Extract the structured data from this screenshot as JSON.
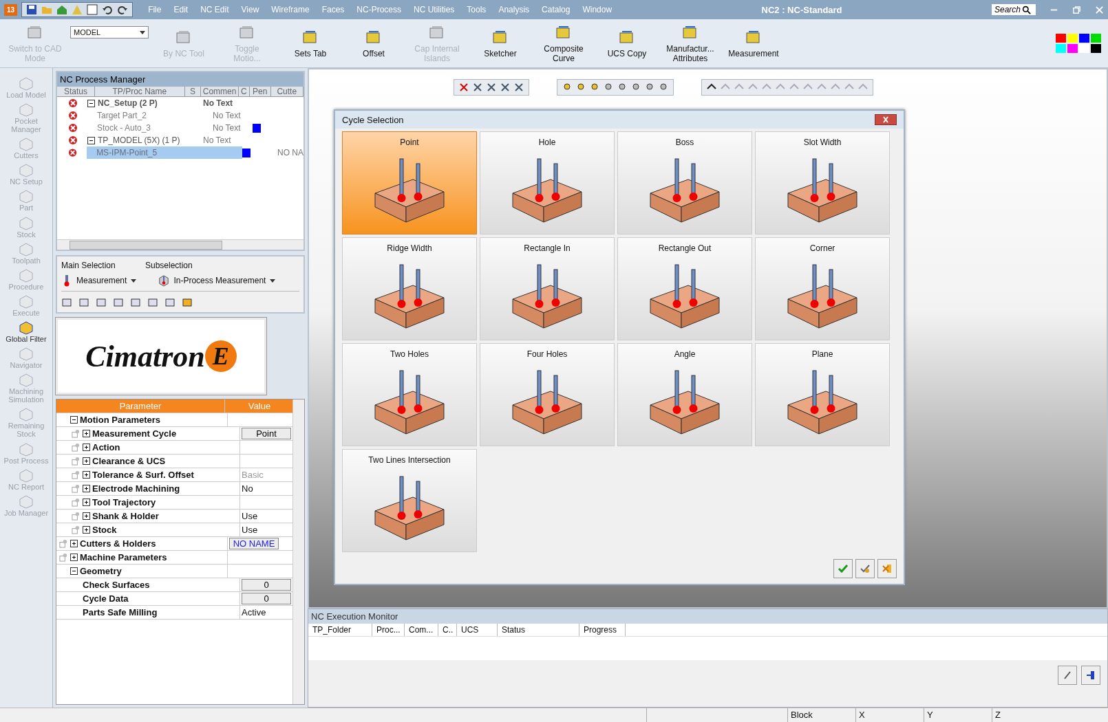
{
  "titlebar": {
    "app_badge": "13",
    "title": "NC2 : NC-Standard",
    "search": {
      "placeholder": "Search"
    }
  },
  "menu": [
    "File",
    "Edit",
    "NC Edit",
    "View",
    "Wireframe",
    "Faces",
    "NC-Process",
    "NC Utilities",
    "Tools",
    "Analysis",
    "Catalog",
    "Window"
  ],
  "ribbon": [
    {
      "kind": "button",
      "label": "Switch to CAD Mode",
      "disabled": true
    },
    {
      "kind": "select",
      "label": "MODEL"
    },
    {
      "kind": "button",
      "label": "By NC Tool",
      "disabled": true
    },
    {
      "kind": "button",
      "label": "Toggle Motio...",
      "disabled": true
    },
    {
      "kind": "button",
      "label": "Sets Tab",
      "disabled": false
    },
    {
      "kind": "button",
      "label": "Offset",
      "disabled": false
    },
    {
      "kind": "button",
      "label": "Cap Internal Islands",
      "disabled": true
    },
    {
      "kind": "button",
      "label": "Sketcher",
      "disabled": false
    },
    {
      "kind": "button",
      "label": "Composite Curve",
      "disabled": false
    },
    {
      "kind": "button",
      "label": "UCS Copy",
      "disabled": false
    },
    {
      "kind": "button",
      "label": "Manufactur... Attributes",
      "disabled": false
    },
    {
      "kind": "button",
      "label": "Measurement",
      "disabled": false
    }
  ],
  "palette": [
    {
      "color": "#ff0000"
    },
    {
      "color": "#ffff00"
    },
    {
      "color": "#0000ff"
    },
    {
      "color": "#00dd00"
    },
    {
      "color": "#00ffff"
    },
    {
      "color": "#ff00ff"
    },
    {
      "color": "#ffffff"
    },
    {
      "color": "#000000"
    }
  ],
  "sidebar": [
    {
      "label": "Load Model",
      "disabled": true
    },
    {
      "label": "Pocket Manager",
      "disabled": true
    },
    {
      "label": "Cutters",
      "disabled": true
    },
    {
      "label": "NC Setup",
      "disabled": true
    },
    {
      "label": "Part",
      "disabled": true
    },
    {
      "label": "Stock",
      "disabled": true
    },
    {
      "label": "Toolpath",
      "disabled": true
    },
    {
      "label": "Procedure",
      "disabled": true
    },
    {
      "label": "Execute",
      "disabled": true
    },
    {
      "label": "Global Filter",
      "disabled": false
    },
    {
      "label": "Navigator",
      "disabled": true
    },
    {
      "label": "Machining Simulation",
      "disabled": true
    },
    {
      "label": "Remaining Stock",
      "disabled": true
    },
    {
      "label": "Post Process",
      "disabled": true
    },
    {
      "label": "NC Report",
      "disabled": true
    },
    {
      "label": "Job Manager",
      "disabled": true
    }
  ],
  "process": {
    "title": "NC Process Manager",
    "columns": [
      "Status",
      "TP/Proc Name",
      "S",
      "Commen",
      "C",
      "Pen",
      "Cutte"
    ],
    "rows": [
      {
        "kind": "setup",
        "name": "NC_Setup (2 P)",
        "comment": "No Text",
        "expanded": true,
        "selected": false,
        "children": [
          {
            "kind": "part",
            "name": "Target Part_2",
            "comment": "No Text",
            "selected": false
          },
          {
            "kind": "part",
            "name": "Stock - Auto_3",
            "comment": "No Text",
            "color": "#0000ff",
            "selected": false
          }
        ]
      },
      {
        "kind": "folder",
        "name": "TP_MODEL (5X) (1 P)",
        "comment": "No Text",
        "expanded": true,
        "selected": false,
        "children": [
          {
            "kind": "procedure",
            "name": "MS-IPM-Point_5",
            "color": "#0000ff",
            "cutter": "NO NA",
            "selected": true
          }
        ]
      }
    ]
  },
  "selection": {
    "main_label": "Main Selection",
    "main_value": "Measurement",
    "sub_label": "Subselection",
    "sub_value": "In-Process Measurement"
  },
  "logo": {
    "text": "Cimatron",
    "badge": "E"
  },
  "params": {
    "columns": [
      "Parameter",
      "Value"
    ],
    "rows": [
      {
        "label": "Motion Parameters",
        "expanded": true,
        "pin": false,
        "children": [
          {
            "label": "Measurement Cycle",
            "expanded": false,
            "pin": true,
            "value": "Point",
            "kind": "button"
          },
          {
            "label": "Action",
            "expanded": false,
            "pin": true
          },
          {
            "label": "Clearance & UCS",
            "expanded": false,
            "pin": true
          },
          {
            "label": "Tolerance & Surf. Offset",
            "expanded": false,
            "pin": true,
            "value": "Basic",
            "kind": "muted"
          },
          {
            "label": "Electrode Machining",
            "expanded": false,
            "pin": true,
            "value": "No",
            "kind": "text"
          },
          {
            "label": "Tool Trajectory",
            "expanded": false,
            "pin": true
          },
          {
            "label": "Shank & Holder",
            "expanded": false,
            "pin": true,
            "value": "Use",
            "kind": "text"
          },
          {
            "label": "Stock",
            "expanded": false,
            "pin": true,
            "value": "Use",
            "kind": "text"
          }
        ]
      },
      {
        "label": "Cutters & Holders",
        "expanded": false,
        "pin": true,
        "value": "NO NAME",
        "kind": "link"
      },
      {
        "label": "Machine Parameters",
        "expanded": false,
        "pin": true
      },
      {
        "label": "Geometry",
        "expanded": true,
        "pin": false,
        "children": [
          {
            "label": "Check Surfaces",
            "pin": false,
            "value": "0",
            "kind": "button"
          },
          {
            "label": "Cycle Data",
            "pin": false,
            "value": "0",
            "kind": "button"
          },
          {
            "label": "Parts Safe Milling",
            "pin": false,
            "value": "Active",
            "kind": "text"
          }
        ]
      }
    ]
  },
  "dialog": {
    "title": "Cycle Selection",
    "tiles": [
      {
        "label": "Point",
        "selected": true
      },
      {
        "label": "Hole",
        "selected": false
      },
      {
        "label": "Boss",
        "selected": false
      },
      {
        "label": "Slot Width",
        "selected": false
      },
      {
        "label": "Ridge Width",
        "selected": false
      },
      {
        "label": "Rectangle In",
        "selected": false
      },
      {
        "label": "Rectangle Out",
        "selected": false
      },
      {
        "label": "Corner",
        "selected": false
      },
      {
        "label": "Two Holes",
        "selected": false
      },
      {
        "label": "Four Holes",
        "selected": false
      },
      {
        "label": "Angle",
        "selected": false
      },
      {
        "label": "Plane",
        "selected": false
      },
      {
        "label": "Two Lines Intersection",
        "selected": false
      }
    ]
  },
  "monitor": {
    "title": "NC Execution Monitor",
    "columns": [
      "TP_Folder",
      "Proc...",
      "Com...",
      "C..",
      "UCS",
      "Status",
      "Progress"
    ]
  },
  "status_bar": [
    "Block",
    "X",
    "Y",
    "Z"
  ]
}
